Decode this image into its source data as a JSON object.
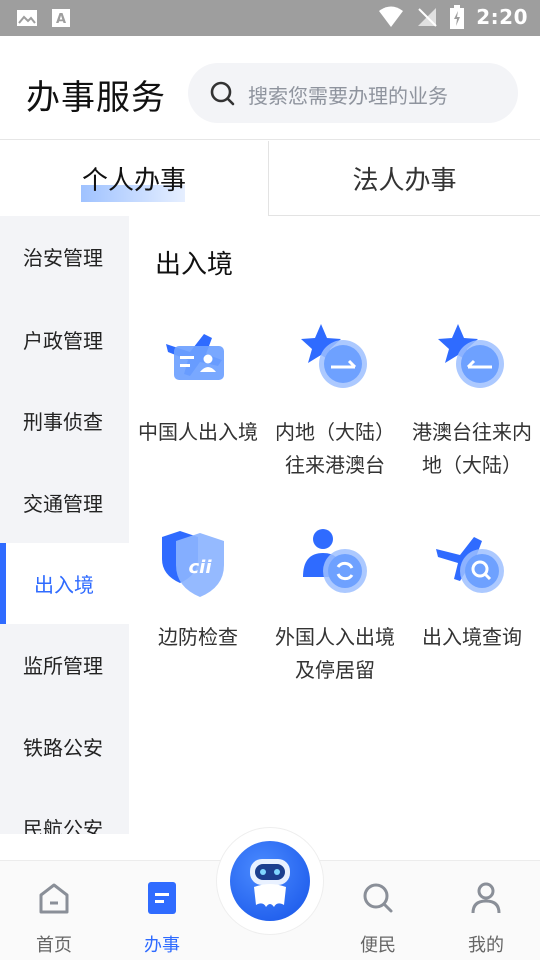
{
  "status_bar": {
    "time": "2:20"
  },
  "header": {
    "title": "办事服务",
    "search_placeholder": "搜索您需要办理的业务"
  },
  "tabs": [
    {
      "label": "个人办事",
      "active": true
    },
    {
      "label": "法人办事",
      "active": false
    }
  ],
  "categories": [
    {
      "label": "治安管理"
    },
    {
      "label": "户政管理"
    },
    {
      "label": "刑事侦查"
    },
    {
      "label": "交通管理"
    },
    {
      "label": "出入境",
      "active": true
    },
    {
      "label": "监所管理"
    },
    {
      "label": "铁路公安"
    },
    {
      "label": "民航公安"
    }
  ],
  "content": {
    "section_title": "出入境",
    "services": [
      {
        "label": "中国人出入境",
        "icon": "id-card-plane-icon"
      },
      {
        "label": "内地（大陆）往来港澳台",
        "icon": "star-arrow-right-icon"
      },
      {
        "label": "港澳台往来内地（大陆）",
        "icon": "star-arrow-left-icon"
      },
      {
        "label": "边防检查",
        "icon": "shield-cii-icon"
      },
      {
        "label": "外国人入出境及停居留",
        "icon": "person-refresh-icon"
      },
      {
        "label": "出入境查询",
        "icon": "plane-search-icon"
      }
    ]
  },
  "bottom_nav": [
    {
      "label": "首页",
      "icon": "home-icon"
    },
    {
      "label": "办事",
      "icon": "document-icon",
      "active": true
    },
    {
      "label": "",
      "icon": "robot-assistant-icon"
    },
    {
      "label": "便民",
      "icon": "search-icon"
    },
    {
      "label": "我的",
      "icon": "user-icon"
    }
  ],
  "colors": {
    "accent": "#2f6bff",
    "sidebar_bg": "#f3f4f7",
    "status_bar": "#9e9e9e"
  }
}
